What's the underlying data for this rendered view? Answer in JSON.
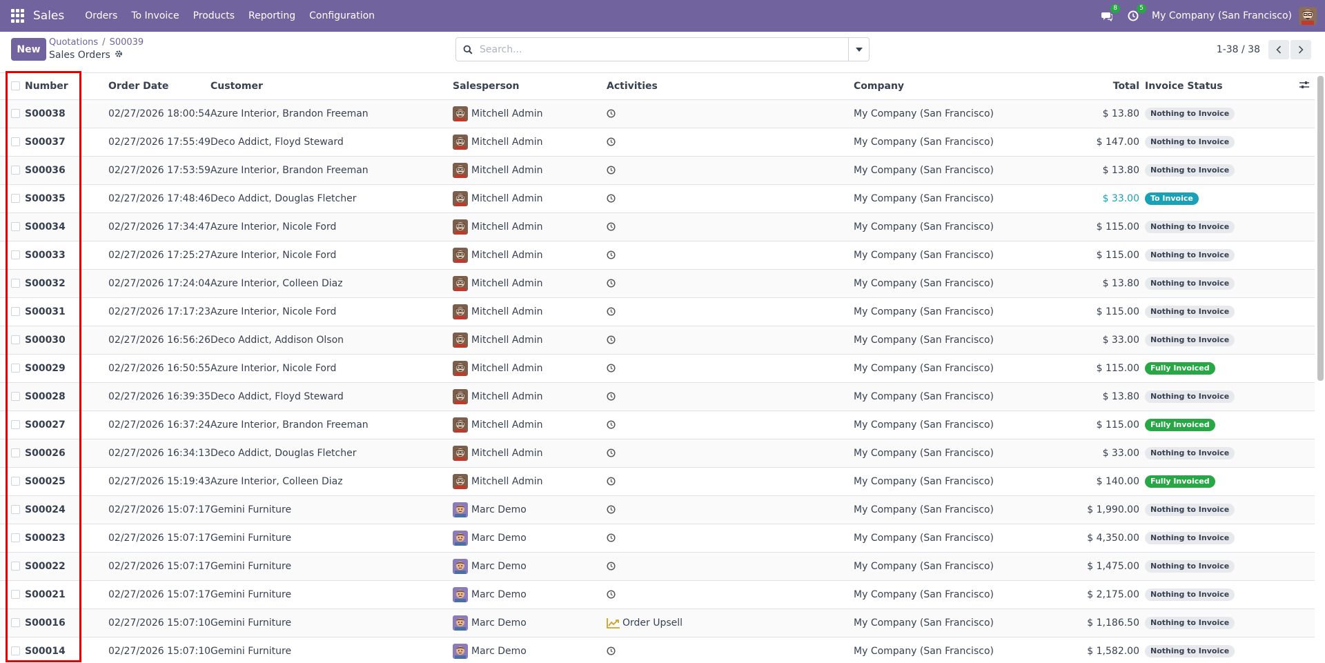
{
  "navbar": {
    "brand": "Sales",
    "menu": [
      "Orders",
      "To Invoice",
      "Products",
      "Reporting",
      "Configuration"
    ],
    "messages_count": "8",
    "activities_count": "5",
    "company": "My Company (San Francisco)"
  },
  "control": {
    "new_label": "New",
    "breadcrumb": [
      "Quotations",
      "S00039"
    ],
    "subtitle": "Sales Orders",
    "search_placeholder": "Search...",
    "pager": "1-38 / 38"
  },
  "columns": {
    "number": "Number",
    "order_date": "Order Date",
    "customer": "Customer",
    "salesperson": "Salesperson",
    "activities": "Activities",
    "company": "Company",
    "total": "Total",
    "invoice_status": "Invoice Status"
  },
  "rows": [
    {
      "number": "S00038",
      "date": "02/27/2026 18:00:54",
      "customer": "Azure Interior, Brandon Freeman",
      "salesperson": "Mitchell Admin",
      "activity": "",
      "company": "My Company (San Francisco)",
      "total": "$ 13.80",
      "status": "Nothing to Invoice"
    },
    {
      "number": "S00037",
      "date": "02/27/2026 17:55:49",
      "customer": "Deco Addict, Floyd Steward",
      "salesperson": "Mitchell Admin",
      "activity": "",
      "company": "My Company (San Francisco)",
      "total": "$ 147.00",
      "status": "Nothing to Invoice"
    },
    {
      "number": "S00036",
      "date": "02/27/2026 17:53:59",
      "customer": "Azure Interior, Brandon Freeman",
      "salesperson": "Mitchell Admin",
      "activity": "",
      "company": "My Company (San Francisco)",
      "total": "$ 13.80",
      "status": "Nothing to Invoice"
    },
    {
      "number": "S00035",
      "date": "02/27/2026 17:48:46",
      "customer": "Deco Addict, Douglas Fletcher",
      "salesperson": "Mitchell Admin",
      "activity": "",
      "company": "My Company (San Francisco)",
      "total": "$ 33.00",
      "status": "To Invoice"
    },
    {
      "number": "S00034",
      "date": "02/27/2026 17:34:47",
      "customer": "Azure Interior, Nicole Ford",
      "salesperson": "Mitchell Admin",
      "activity": "",
      "company": "My Company (San Francisco)",
      "total": "$ 115.00",
      "status": "Nothing to Invoice"
    },
    {
      "number": "S00033",
      "date": "02/27/2026 17:25:27",
      "customer": "Azure Interior, Nicole Ford",
      "salesperson": "Mitchell Admin",
      "activity": "",
      "company": "My Company (San Francisco)",
      "total": "$ 115.00",
      "status": "Nothing to Invoice"
    },
    {
      "number": "S00032",
      "date": "02/27/2026 17:24:04",
      "customer": "Azure Interior, Colleen Diaz",
      "salesperson": "Mitchell Admin",
      "activity": "",
      "company": "My Company (San Francisco)",
      "total": "$ 13.80",
      "status": "Nothing to Invoice"
    },
    {
      "number": "S00031",
      "date": "02/27/2026 17:17:23",
      "customer": "Azure Interior, Nicole Ford",
      "salesperson": "Mitchell Admin",
      "activity": "",
      "company": "My Company (San Francisco)",
      "total": "$ 115.00",
      "status": "Nothing to Invoice"
    },
    {
      "number": "S00030",
      "date": "02/27/2026 16:56:26",
      "customer": "Deco Addict, Addison Olson",
      "salesperson": "Mitchell Admin",
      "activity": "",
      "company": "My Company (San Francisco)",
      "total": "$ 33.00",
      "status": "Nothing to Invoice"
    },
    {
      "number": "S00029",
      "date": "02/27/2026 16:50:55",
      "customer": "Azure Interior, Nicole Ford",
      "salesperson": "Mitchell Admin",
      "activity": "",
      "company": "My Company (San Francisco)",
      "total": "$ 115.00",
      "status": "Fully Invoiced"
    },
    {
      "number": "S00028",
      "date": "02/27/2026 16:39:35",
      "customer": "Deco Addict, Floyd Steward",
      "salesperson": "Mitchell Admin",
      "activity": "",
      "company": "My Company (San Francisco)",
      "total": "$ 13.80",
      "status": "Nothing to Invoice"
    },
    {
      "number": "S00027",
      "date": "02/27/2026 16:37:24",
      "customer": "Azure Interior, Brandon Freeman",
      "salesperson": "Mitchell Admin",
      "activity": "",
      "company": "My Company (San Francisco)",
      "total": "$ 115.00",
      "status": "Fully Invoiced"
    },
    {
      "number": "S00026",
      "date": "02/27/2026 16:34:13",
      "customer": "Deco Addict, Douglas Fletcher",
      "salesperson": "Mitchell Admin",
      "activity": "",
      "company": "My Company (San Francisco)",
      "total": "$ 33.00",
      "status": "Nothing to Invoice"
    },
    {
      "number": "S00025",
      "date": "02/27/2026 15:19:43",
      "customer": "Azure Interior, Colleen Diaz",
      "salesperson": "Mitchell Admin",
      "activity": "",
      "company": "My Company (San Francisco)",
      "total": "$ 140.00",
      "status": "Fully Invoiced"
    },
    {
      "number": "S00024",
      "date": "02/27/2026 15:07:17",
      "customer": "Gemini Furniture",
      "salesperson": "Marc Demo",
      "activity": "",
      "company": "My Company (San Francisco)",
      "total": "$ 1,990.00",
      "status": "Nothing to Invoice"
    },
    {
      "number": "S00023",
      "date": "02/27/2026 15:07:17",
      "customer": "Gemini Furniture",
      "salesperson": "Marc Demo",
      "activity": "",
      "company": "My Company (San Francisco)",
      "total": "$ 4,350.00",
      "status": "Nothing to Invoice"
    },
    {
      "number": "S00022",
      "date": "02/27/2026 15:07:17",
      "customer": "Gemini Furniture",
      "salesperson": "Marc Demo",
      "activity": "",
      "company": "My Company (San Francisco)",
      "total": "$ 1,475.00",
      "status": "Nothing to Invoice"
    },
    {
      "number": "S00021",
      "date": "02/27/2026 15:07:17",
      "customer": "Gemini Furniture",
      "salesperson": "Marc Demo",
      "activity": "",
      "company": "My Company (San Francisco)",
      "total": "$ 2,175.00",
      "status": "Nothing to Invoice"
    },
    {
      "number": "S00016",
      "date": "02/27/2026 15:07:10",
      "customer": "Gemini Furniture",
      "salesperson": "Marc Demo",
      "activity": "Order Upsell",
      "company": "My Company (San Francisco)",
      "total": "$ 1,186.50",
      "status": "Nothing to Invoice"
    },
    {
      "number": "S00014",
      "date": "02/27/2026 15:07:10",
      "customer": "Gemini Furniture",
      "salesperson": "Marc Demo",
      "activity": "",
      "company": "My Company (San Francisco)",
      "total": "$ 1,582.00",
      "status": "Nothing to Invoice"
    }
  ],
  "colors": {
    "brand": "#71639e",
    "to_invoice": "#17a2b8",
    "fully_invoiced": "#28a745",
    "highlight": "#e00000"
  }
}
